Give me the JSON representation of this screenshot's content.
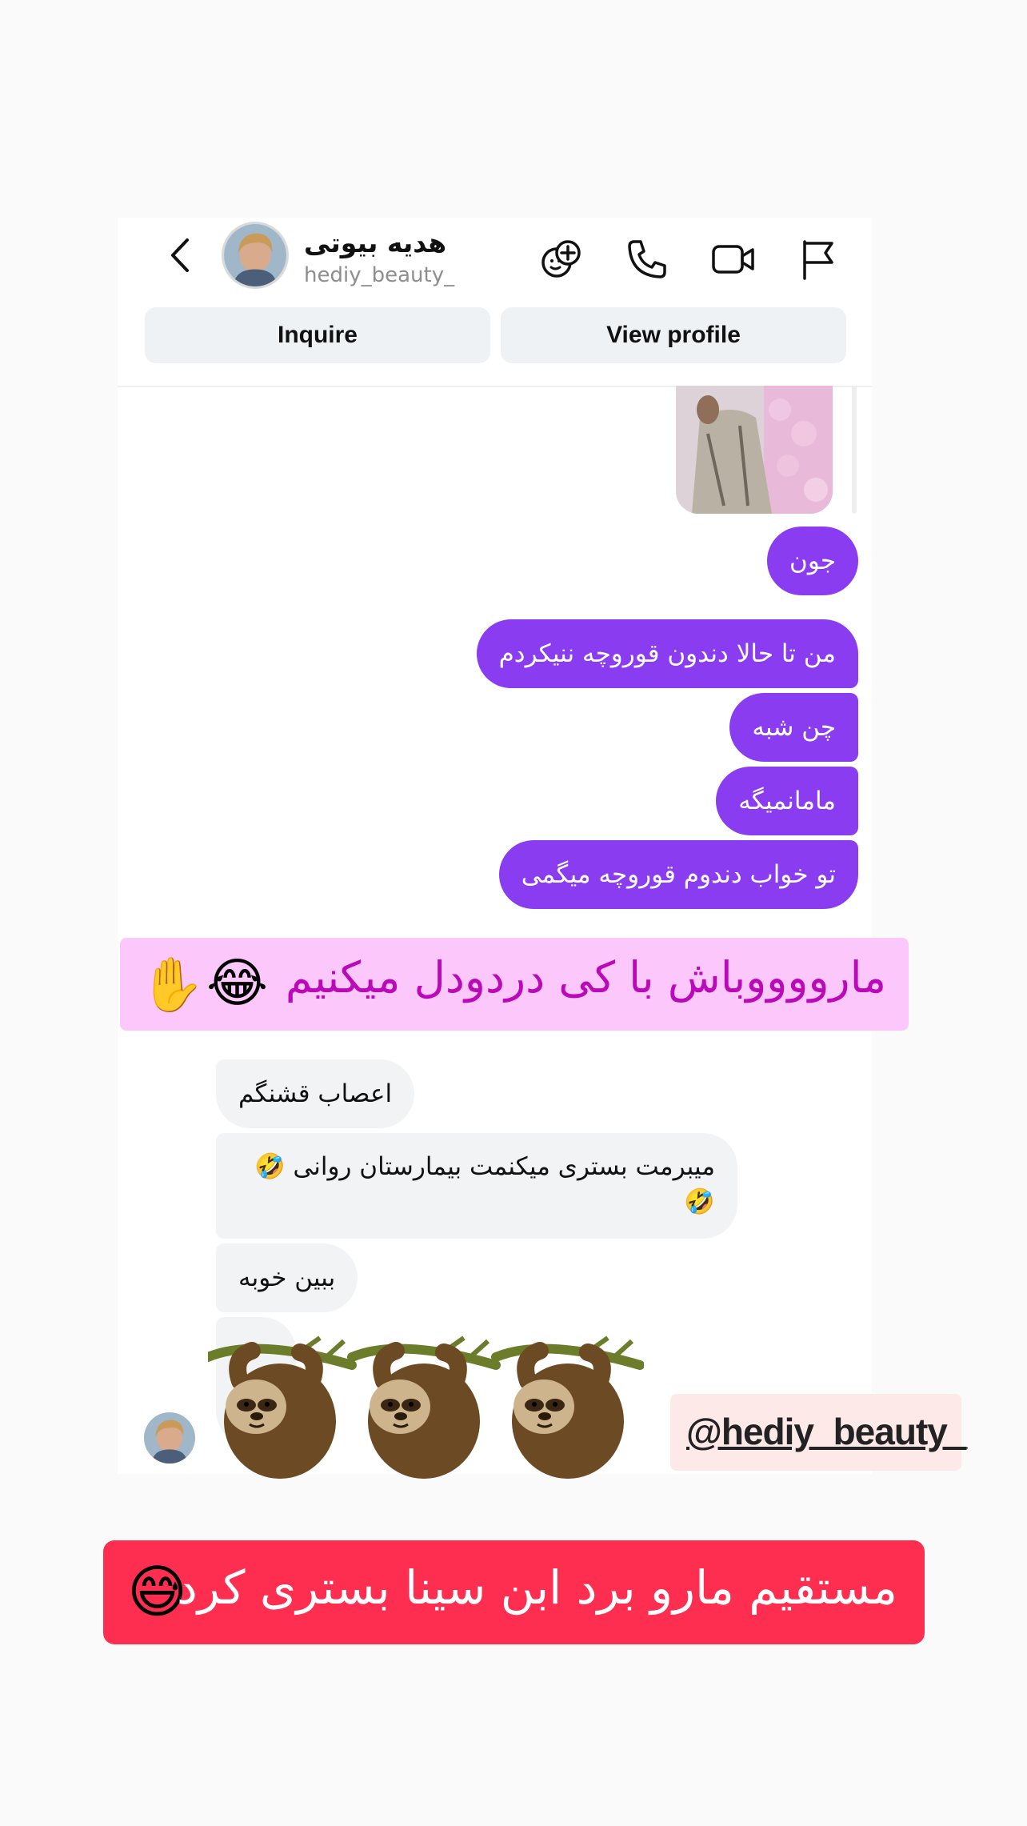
{
  "header": {
    "display_name": "هدیه  بیوتی",
    "username": "hediy_beauty_",
    "inquire_label": "Inquire",
    "view_profile_label": "View profile"
  },
  "messages_out": [
    {
      "text": "جون"
    },
    {
      "text": "من تا حالا  دندون قوروچه ننیکردم"
    },
    {
      "text": "چن شبه"
    },
    {
      "text": "مامانمیگه"
    },
    {
      "text": "تو خواب دندوم قوروچه میگمی"
    }
  ],
  "messages_in": [
    {
      "text": "اعصاب قشنگم"
    },
    {
      "text": "میبرمت بستری میکنمت بیمارستان روانی 🤣🤣"
    },
    {
      "text": "ببین خوبه"
    }
  ],
  "sticker_banner": {
    "text": "مارووووباش  با کی دردودل میکنیم"
  },
  "handle_sticker": {
    "text": "@hediy_beauty_"
  },
  "red_banner": {
    "text": "مستقیم مارو برد ابن سینا بستری کرد"
  },
  "colors": {
    "outgoing_bubble": "#8a3cf0",
    "incoming_bubble": "#f2f3f5",
    "sticker_banner_bg": "#fcc8fc",
    "sticker_banner_text": "#bb08b8",
    "red_banner_bg": "#fe2e51"
  }
}
